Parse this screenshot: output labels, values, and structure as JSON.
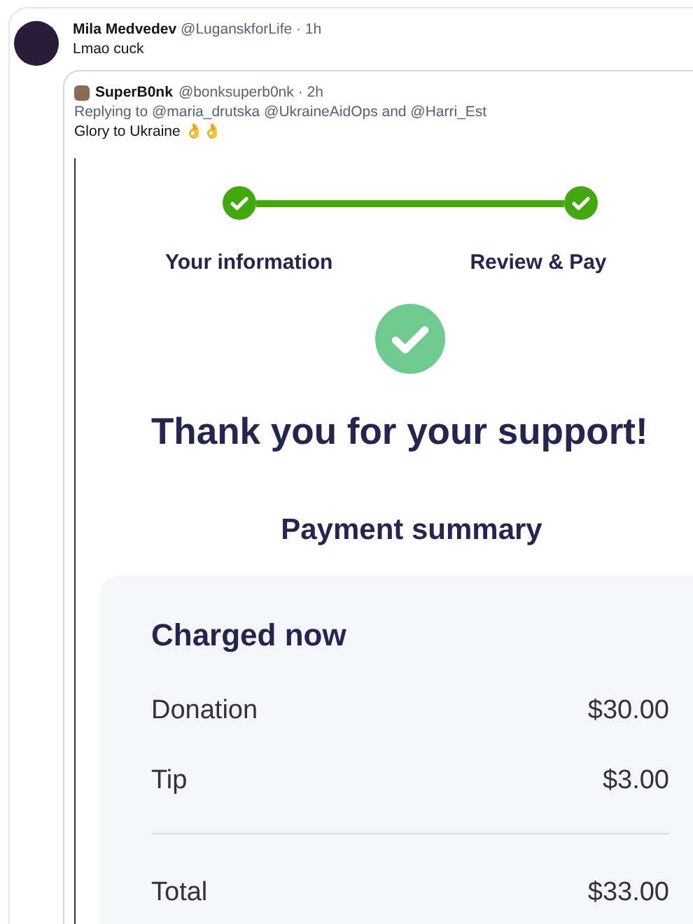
{
  "tweet": {
    "name": "Mila Medvedev",
    "handle": "@LuganskforLife · 1h",
    "text": "Lmao cuck",
    "quote": {
      "name": "SuperB0nk",
      "handle": "@bonksuperb0nk · 2h",
      "replying": "Replying to @maria_drutska @UkraineAidOps and @Harri_Est",
      "text": "Glory to Ukraine 👌👌",
      "screenshot": {
        "steps": [
          {
            "label": "Your information",
            "done": true
          },
          {
            "label": "Review & Pay",
            "done": true
          }
        ],
        "heading": "Thank you for your support!",
        "summary_title": "Payment summary",
        "panel_title": "Charged now",
        "rows": [
          {
            "label": "Donation",
            "amount": "$30.00"
          },
          {
            "label": "Tip",
            "amount": "$3.00"
          }
        ],
        "total": {
          "label": "Total",
          "amount": "$33.00"
        }
      }
    }
  }
}
